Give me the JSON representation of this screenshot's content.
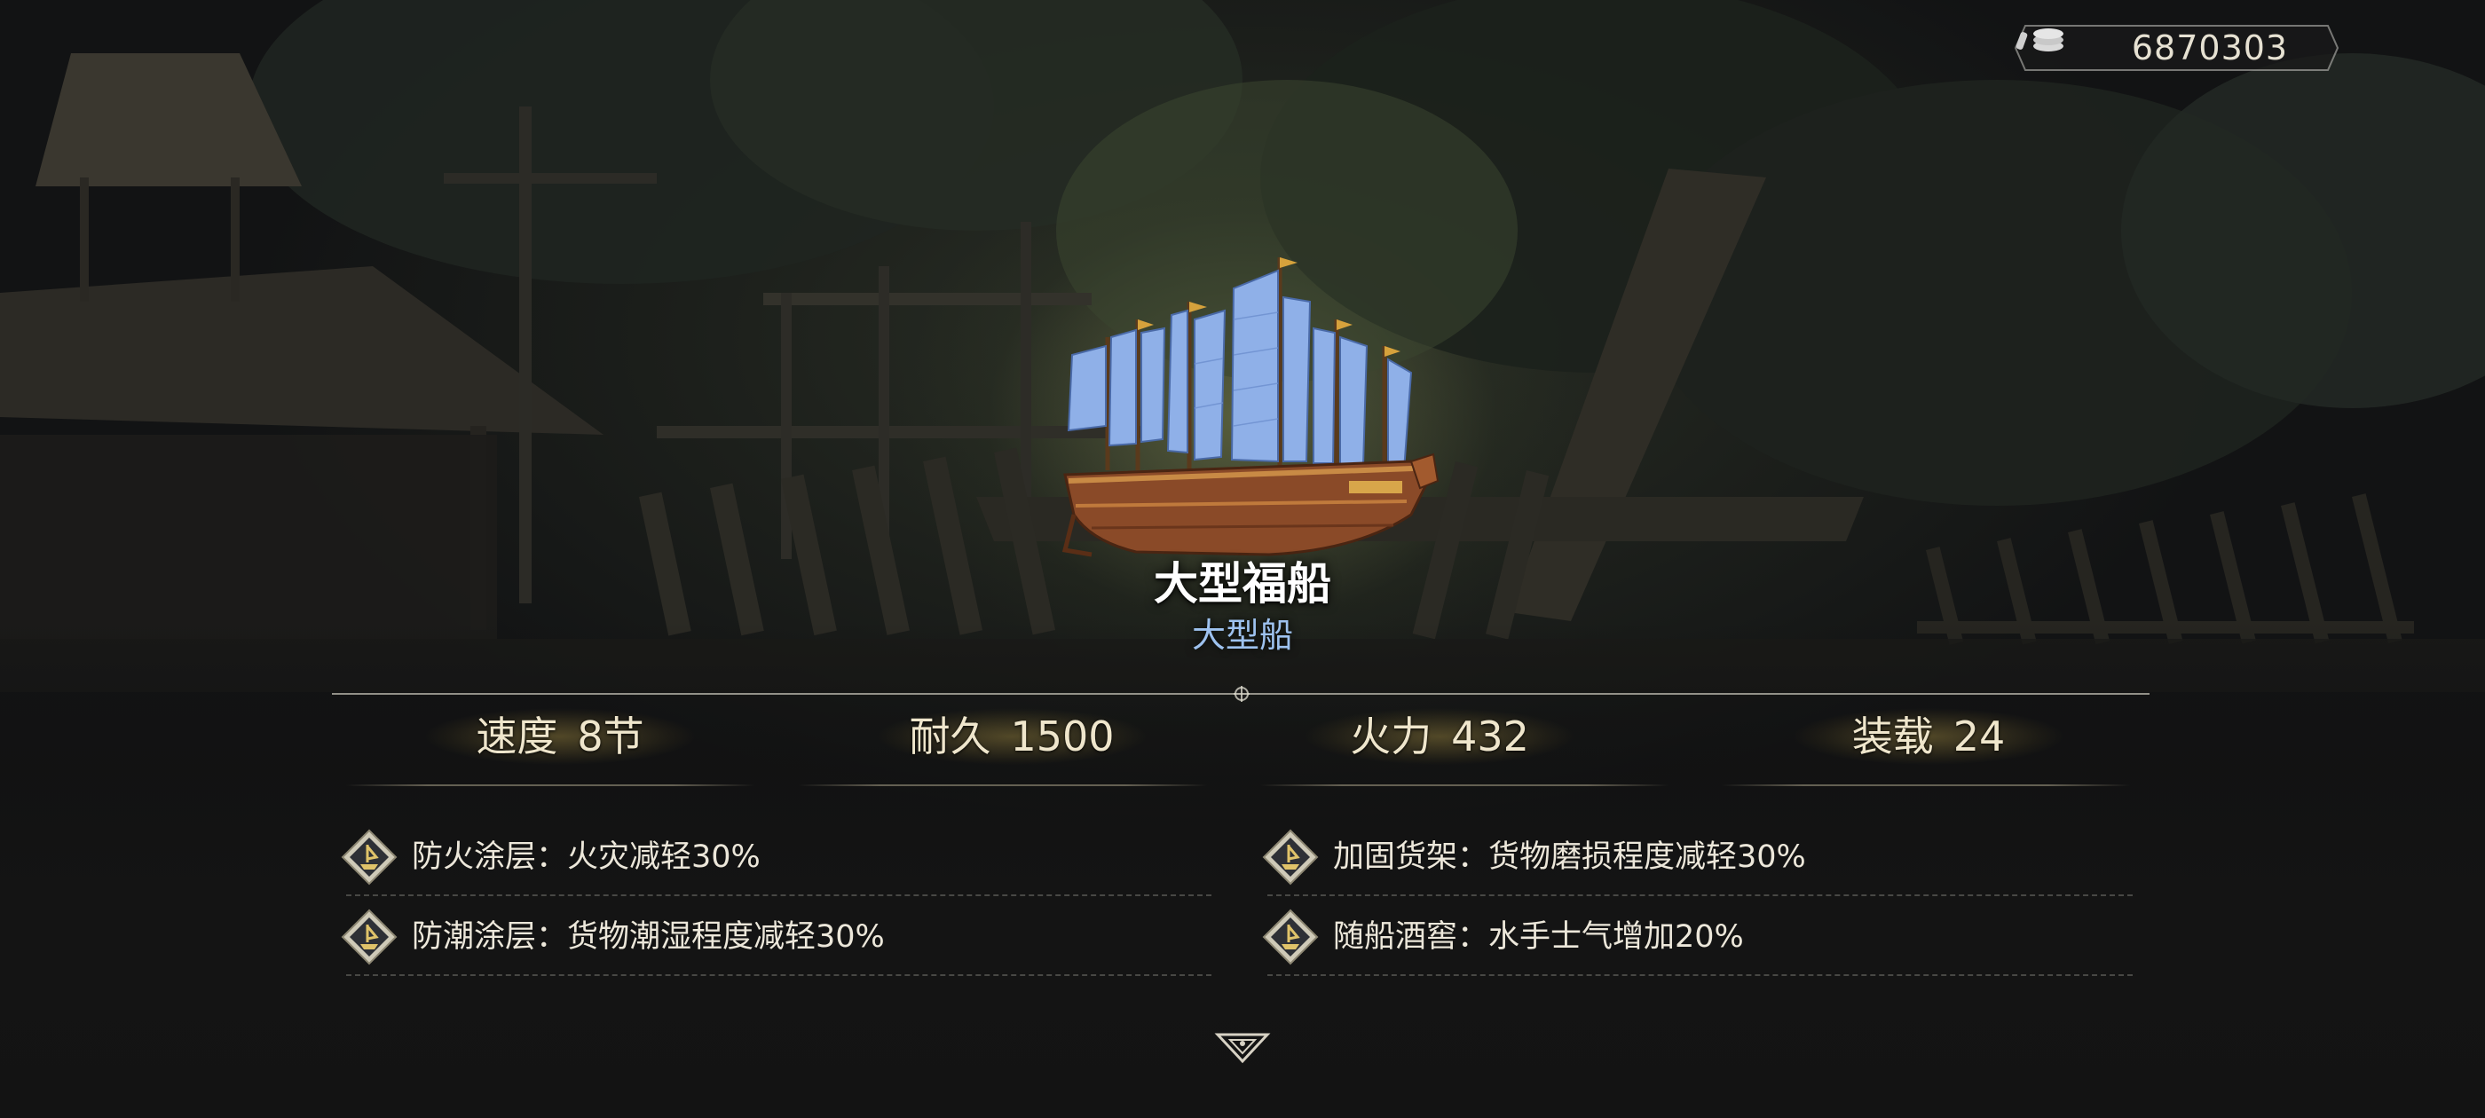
{
  "currency": {
    "icon": "silver-coin-icon",
    "value": "6870303"
  },
  "ship": {
    "name": "大型福船",
    "type": "大型船",
    "illustration": "ship-illustration"
  },
  "stats": [
    {
      "label": "速度",
      "value": "8节"
    },
    {
      "label": "耐久",
      "value": "1500"
    },
    {
      "label": "火力",
      "value": "432"
    },
    {
      "label": "装载",
      "value": "24"
    }
  ],
  "features": [
    {
      "icon": "ship-upgrade-icon",
      "text": "防火涂层：火灾减轻30%"
    },
    {
      "icon": "ship-upgrade-icon",
      "text": "加固货架：货物磨损程度减轻30%"
    },
    {
      "icon": "ship-upgrade-icon",
      "text": "防潮涂层：货物潮湿程度减轻30%"
    },
    {
      "icon": "ship-upgrade-icon",
      "text": "随船酒窖：水手士气增加20%"
    }
  ],
  "footer": {
    "icon": "chevron-down-icon"
  },
  "colors": {
    "ship_type": "#9ec2ef",
    "stat_text": "#efe6cc",
    "feature_text": "#ece7da",
    "sail_blue": "#8fb0e8",
    "hull_brown": "#8a4a28"
  }
}
